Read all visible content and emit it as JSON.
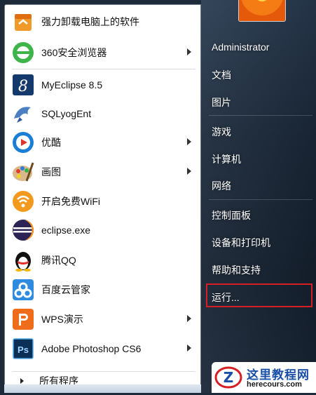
{
  "left_menu": {
    "items": [
      {
        "label": "强力卸载电脑上的软件",
        "icon": "uninstall-box-icon",
        "submenu": false
      },
      {
        "label": "360安全浏览器",
        "icon": "360-browser-icon",
        "submenu": true
      },
      {
        "label": "MyEclipse 8.5",
        "icon": "myeclipse-icon",
        "submenu": false
      },
      {
        "label": "SQLyogEnt",
        "icon": "sqlyog-dolphin-icon",
        "submenu": false
      },
      {
        "label": "优酷",
        "icon": "youku-play-icon",
        "submenu": true
      },
      {
        "label": "画图",
        "icon": "paint-palette-icon",
        "submenu": true
      },
      {
        "label": "开启免费WiFi",
        "icon": "wifi-icon",
        "submenu": false
      },
      {
        "label": "eclipse.exe",
        "icon": "eclipse-icon",
        "submenu": false
      },
      {
        "label": "腾讯QQ",
        "icon": "qq-penguin-icon",
        "submenu": false
      },
      {
        "label": "百度云管家",
        "icon": "baidu-cloud-icon",
        "submenu": false
      },
      {
        "label": "WPS演示",
        "icon": "wps-presentation-icon",
        "submenu": true
      },
      {
        "label": "Adobe Photoshop CS6",
        "icon": "photoshop-icon",
        "submenu": true
      }
    ],
    "all_programs": "所有程序"
  },
  "right_menu": {
    "user": "Administrator",
    "items": [
      "文档",
      "图片",
      "游戏",
      "计算机",
      "网络",
      "控制面板",
      "设备和打印机",
      "帮助和支持",
      "运行..."
    ]
  },
  "watermark": {
    "title": "这里教程网",
    "url": "herecours.com"
  },
  "colors": {
    "highlight_box": "#d51f24",
    "right_pane": "#1c2a3b"
  }
}
